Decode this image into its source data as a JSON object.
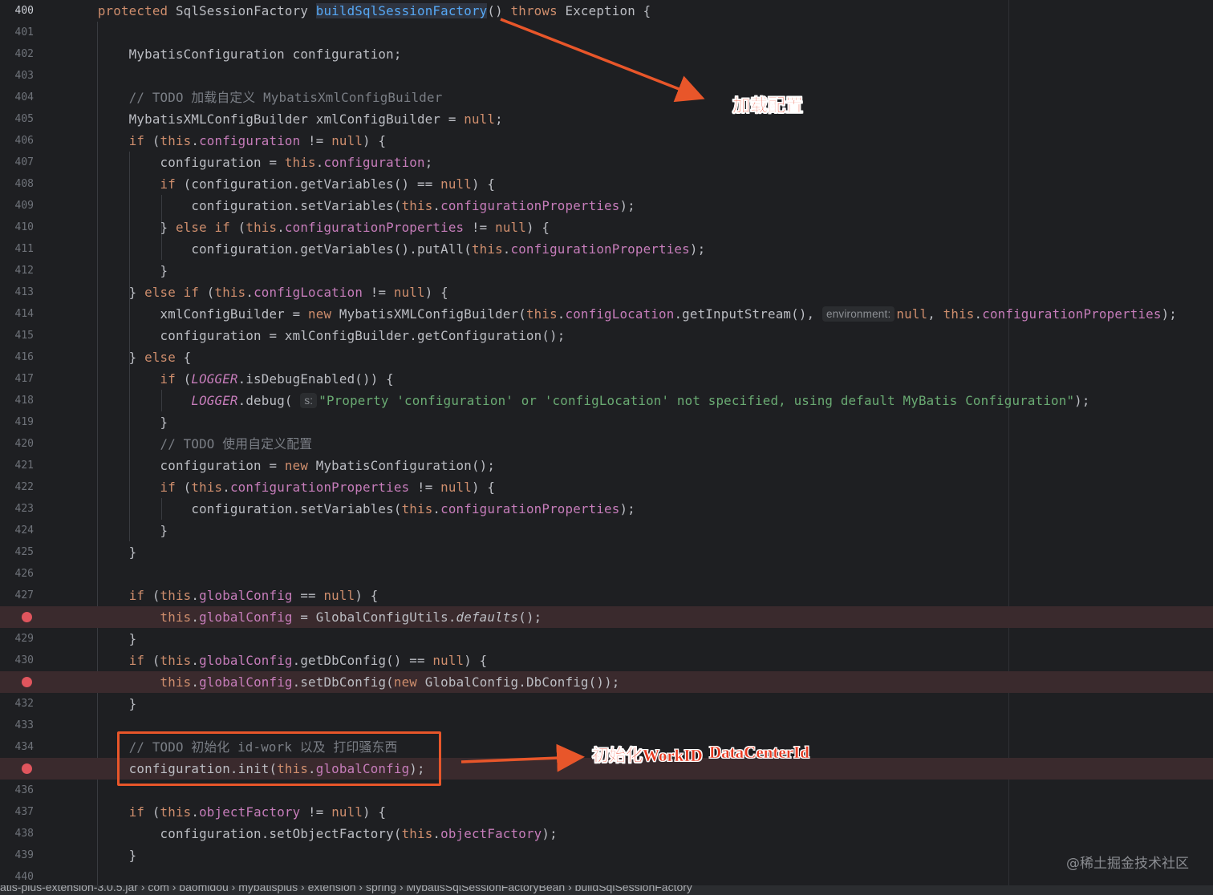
{
  "editor": {
    "lines": [
      {
        "num": "400",
        "current": true,
        "html": "    <span class=\"k\">protected</span> SqlSessionFactory <span class=\"fh\">buildSqlSessionFactory</span>() <span class=\"k\">throws</span> Exception {"
      },
      {
        "num": "401",
        "html": ""
      },
      {
        "num": "402",
        "html": "        MybatisConfiguration configuration;"
      },
      {
        "num": "403",
        "html": ""
      },
      {
        "num": "404",
        "html": "        <span class=\"c\">// TODO 加载自定义 MybatisXmlConfigBuilder</span>"
      },
      {
        "num": "405",
        "html": "        MybatisXMLConfigBuilder xmlConfigBuilder = <span class=\"k\">null</span>;"
      },
      {
        "num": "406",
        "html": "        <span class=\"k\">if</span> (<span class=\"k\">this</span>.<span class=\"p\">configuration</span> != <span class=\"k\">null</span>) {"
      },
      {
        "num": "407",
        "html": "            configuration = <span class=\"k\">this</span>.<span class=\"p\">configuration</span>;"
      },
      {
        "num": "408",
        "html": "            <span class=\"k\">if</span> (configuration.getVariables() == <span class=\"k\">null</span>) {"
      },
      {
        "num": "409",
        "html": "                configuration.setVariables(<span class=\"k\">this</span>.<span class=\"p\">configurationProperties</span>);"
      },
      {
        "num": "410",
        "html": "            } <span class=\"k\">else if</span> (<span class=\"k\">this</span>.<span class=\"p\">configurationProperties</span> != <span class=\"k\">null</span>) {"
      },
      {
        "num": "411",
        "html": "                configuration.getVariables().putAll(<span class=\"k\">this</span>.<span class=\"p\">configurationProperties</span>);"
      },
      {
        "num": "412",
        "html": "            }"
      },
      {
        "num": "413",
        "html": "        } <span class=\"k\">else if</span> (<span class=\"k\">this</span>.<span class=\"p\">configLocation</span> != <span class=\"k\">null</span>) {"
      },
      {
        "num": "414",
        "html": "            xmlConfigBuilder = <span class=\"k\">new</span> MybatisXMLConfigBuilder(<span class=\"k\">this</span>.<span class=\"p\">configLocation</span>.getInputStream(), <span class=\"hint\">environment:</span><span class=\"k\">null</span>, <span class=\"k\">this</span>.<span class=\"p\">configurationProperties</span>);"
      },
      {
        "num": "415",
        "html": "            configuration = xmlConfigBuilder.getConfiguration();"
      },
      {
        "num": "416",
        "html": "        } <span class=\"k\">else</span> {"
      },
      {
        "num": "417",
        "html": "            <span class=\"k\">if</span> (<span class=\"p it\">LOGGER</span>.isDebugEnabled()) {"
      },
      {
        "num": "418",
        "html": "                <span class=\"p it\">LOGGER</span>.debug( <span class=\"hint\">s:</span><span class=\"s\">\"Property 'configuration' or 'configLocation' not specified, using default MyBatis Configuration\"</span>);"
      },
      {
        "num": "419",
        "html": "            }"
      },
      {
        "num": "420",
        "html": "            <span class=\"c\">// TODO 使用自定义配置</span>"
      },
      {
        "num": "421",
        "html": "            configuration = <span class=\"k\">new</span> MybatisConfiguration();"
      },
      {
        "num": "422",
        "html": "            <span class=\"k\">if</span> (<span class=\"k\">this</span>.<span class=\"p\">configurationProperties</span> != <span class=\"k\">null</span>) {"
      },
      {
        "num": "423",
        "html": "                configuration.setVariables(<span class=\"k\">this</span>.<span class=\"p\">configurationProperties</span>);"
      },
      {
        "num": "424",
        "html": "            }"
      },
      {
        "num": "425",
        "html": "        }"
      },
      {
        "num": "426",
        "html": ""
      },
      {
        "num": "427",
        "html": "        <span class=\"k\">if</span> (<span class=\"k\">this</span>.<span class=\"p\">globalConfig</span> == <span class=\"k\">null</span>) {"
      },
      {
        "num": "428",
        "breakpoint": true,
        "html": "            <span class=\"k\">this</span>.<span class=\"p\">globalConfig</span> = GlobalConfigUtils.<span class=\"it\">defaults</span>();"
      },
      {
        "num": "429",
        "html": "        }"
      },
      {
        "num": "430",
        "html": "        <span class=\"k\">if</span> (<span class=\"k\">this</span>.<span class=\"p\">globalConfig</span>.getDbConfig() == <span class=\"k\">null</span>) {"
      },
      {
        "num": "431",
        "breakpoint": true,
        "html": "            <span class=\"k\">this</span>.<span class=\"p\">globalConfig</span>.setDbConfig(<span class=\"k\">new</span> GlobalConfig.DbConfig());"
      },
      {
        "num": "432",
        "html": "        }"
      },
      {
        "num": "433",
        "html": ""
      },
      {
        "num": "434",
        "html": "        <span class=\"c\">// TODO 初始化 id-work 以及 打印骚东西</span>"
      },
      {
        "num": "435",
        "breakpoint": true,
        "html": "        configuration.init(<span class=\"k\">this</span>.<span class=\"p\">globalConfig</span>);"
      },
      {
        "num": "436",
        "html": ""
      },
      {
        "num": "437",
        "html": "        <span class=\"k\">if</span> (<span class=\"k\">this</span>.<span class=\"p\">objectFactory</span> != <span class=\"k\">null</span>) {"
      },
      {
        "num": "438",
        "html": "            configuration.setObjectFactory(<span class=\"k\">this</span>.<span class=\"p\">objectFactory</span>);"
      },
      {
        "num": "439",
        "html": "        }"
      },
      {
        "num": "440",
        "html": ""
      }
    ]
  },
  "annotations": {
    "load_config": "加载配置",
    "init_label": "初始化WorkID",
    "datacenter_label": "DataCenterId"
  },
  "watermark": "@稀土掘金技术社区",
  "status_bar": "atis-plus-extension-3.0.5.jar  ›  com  ›  baomidou  ›  mybatisplus  ›  extension  ›  spring  ›  MybatisSqlSessionFactoryBean  ›  buildSqlSessionFactory",
  "colors": {
    "background": "#1e1f22",
    "keyword": "#cf8e6d",
    "field": "#c77dbb",
    "method": "#56a8f5",
    "string": "#6aab73",
    "comment": "#7a7e85",
    "breakpoint": "#e0555d",
    "annotation": "#e8381f"
  }
}
